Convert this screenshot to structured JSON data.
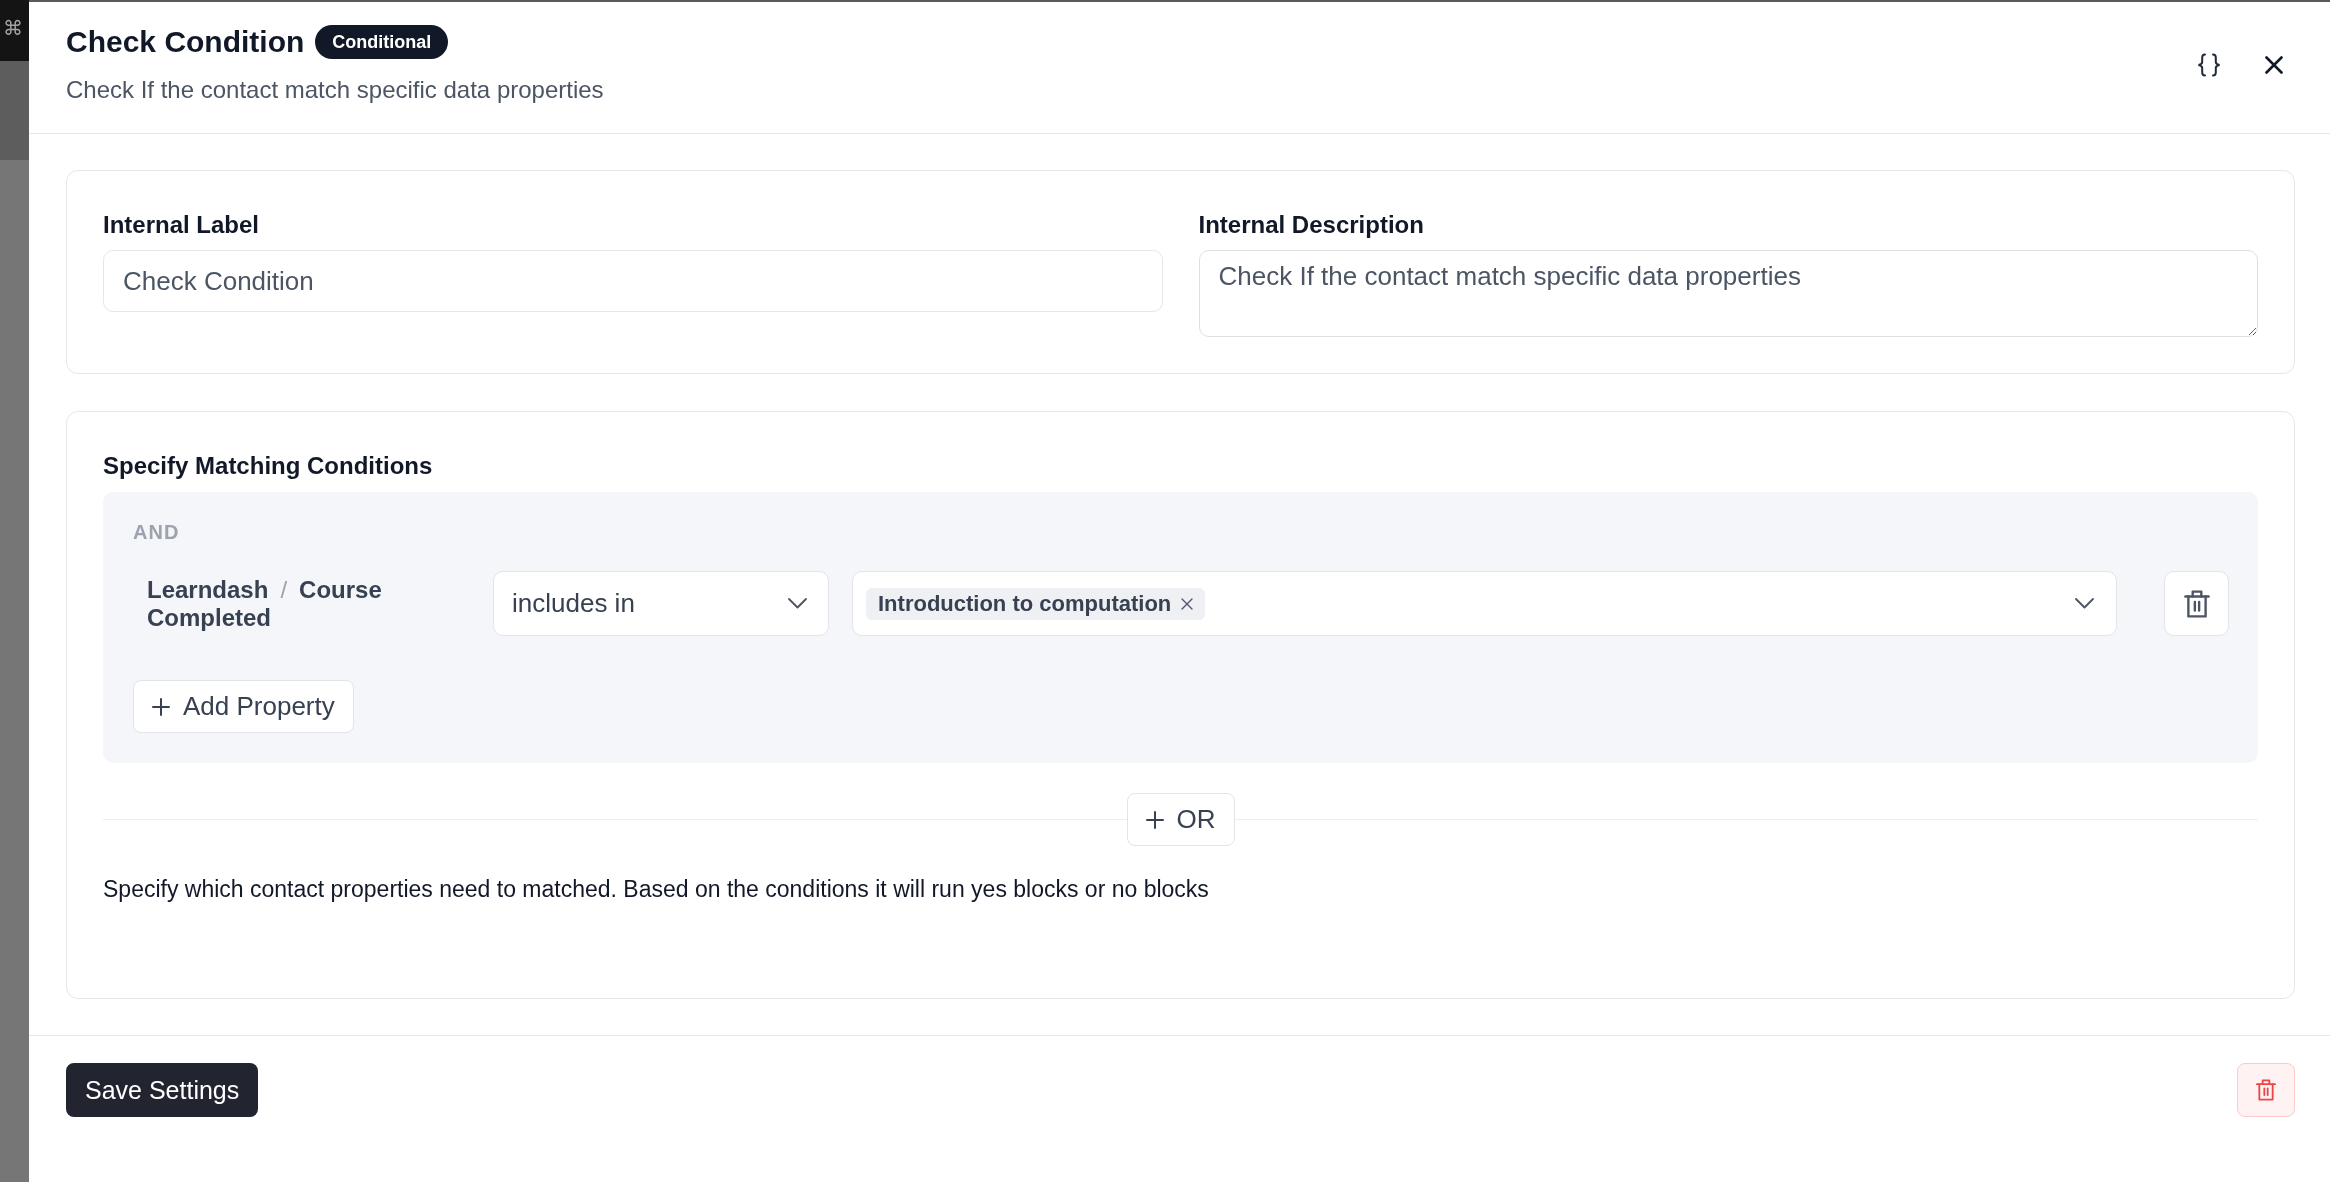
{
  "backdrop": {
    "shortcut": "⌘"
  },
  "header": {
    "title": "Check Condition",
    "badge": "Conditional",
    "subtitle": "Check If the contact match specific data properties"
  },
  "settings": {
    "fields": [
      {
        "kind": "input",
        "label": "Internal Label",
        "value": "Check Condition"
      },
      {
        "kind": "textarea",
        "label": "Internal Description",
        "value": "Check If the contact match specific data properties"
      }
    ]
  },
  "conditions": {
    "title": "Specify Matching Conditions",
    "groups": [
      {
        "join": "AND",
        "rules": [
          {
            "property": {
              "source": "Learndash",
              "separator": "/",
              "name": "Course Completed"
            },
            "operator": "includes in",
            "values": [
              "Introduction to computation"
            ]
          }
        ],
        "add_button": "Add Property"
      }
    ],
    "or_button": "OR",
    "help": "Specify which contact properties need to matched. Based on the conditions it will run yes blocks or no blocks"
  },
  "footer": {
    "save_button": "Save Settings"
  }
}
